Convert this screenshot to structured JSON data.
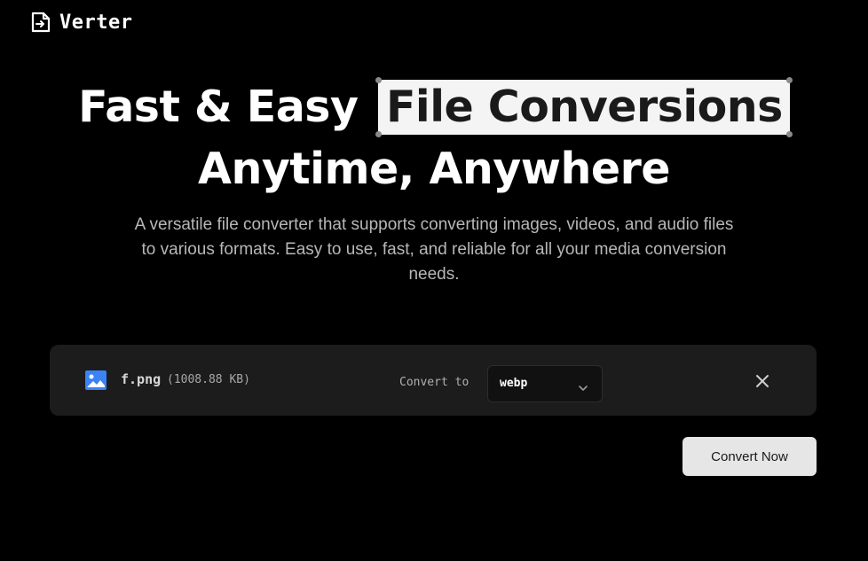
{
  "app": {
    "name": "Verter",
    "logo_icon": "file-arrow-icon"
  },
  "hero": {
    "title_part1": "Fast & Easy",
    "title_highlight": "File Conversions",
    "title_line2": "Anytime, Anywhere",
    "subtitle": "A versatile file converter that supports converting images, videos, and audio files to various formats. Easy to use, fast, and reliable for all your media conversion needs."
  },
  "file": {
    "icon": "image-icon",
    "name": "f.png",
    "size": "(1008.88 KB)",
    "convert_label": "Convert to",
    "format": "webp",
    "remove_icon": "close-icon"
  },
  "actions": {
    "convert_label": "Convert Now"
  },
  "colors": {
    "background": "#000000",
    "card": "#1c1c1c",
    "highlight_bg": "#f4f4f4",
    "button_bg": "#e6e6e6",
    "image_icon": "#3b82f6"
  }
}
